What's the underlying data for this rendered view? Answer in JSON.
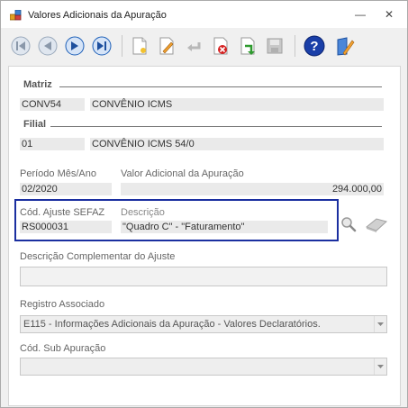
{
  "window": {
    "title": "Valores Adicionais da Apuração",
    "minimize_glyph": "—",
    "close_glyph": "✕"
  },
  "toolbar": {
    "buttons": [
      {
        "icon": "first-record-icon"
      },
      {
        "icon": "previous-record-icon"
      },
      {
        "icon": "next-record-icon"
      },
      {
        "icon": "last-record-icon"
      },
      {
        "icon": "new-document-icon"
      },
      {
        "icon": "edit-icon"
      },
      {
        "icon": "undo-icon"
      },
      {
        "icon": "delete-icon"
      },
      {
        "icon": "confirm-icon"
      },
      {
        "icon": "save-icon"
      },
      {
        "icon": "help-icon"
      },
      {
        "icon": "notes-icon"
      }
    ]
  },
  "matriz": {
    "section_label": "Matriz",
    "code": "CONV54",
    "name": "CONVÊNIO ICMS"
  },
  "filial": {
    "section_label": "Filial",
    "code": "01",
    "name": "CONVÊNIO ICMS 54/0"
  },
  "periodo": {
    "label": "Período Mês/Ano",
    "value": "02/2020"
  },
  "valor_adicional": {
    "label": "Valor Adicional da Apuração",
    "value": "294.000,00"
  },
  "ajuste": {
    "code_label": "Cód. Ajuste SEFAZ",
    "code_value": "RS000031",
    "desc_label": "Descrição",
    "desc_value": "\"Quadro C\" - \"Faturamento\""
  },
  "descricao_complementar": {
    "label": "Descrição Complementar do Ajuste",
    "value": ""
  },
  "registro_associado": {
    "label": "Registro Associado",
    "value": "E115 - Informações Adicionais da Apuração - Valores Declaratórios."
  },
  "sub_apuracao": {
    "label": "Cód. Sub Apuração",
    "value": ""
  },
  "colors": {
    "highlight": "#1b2fa0",
    "nav_blue": "#1d5fb8"
  }
}
